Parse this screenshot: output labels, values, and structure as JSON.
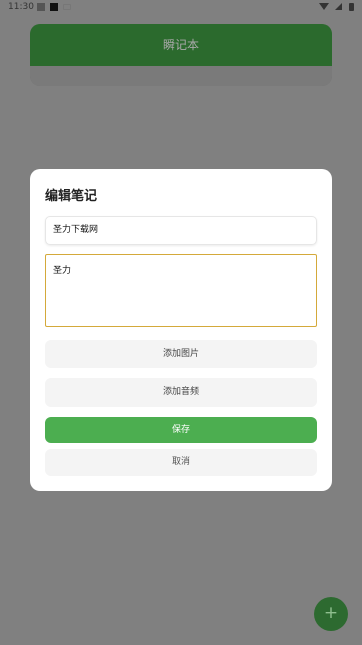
{
  "status_bar": {
    "time": "11:30"
  },
  "app": {
    "title": "瞬记本"
  },
  "dialog": {
    "title": "编辑笔记",
    "title_value": "圣力下载网",
    "body_value": "圣力",
    "add_image_label": "添加图片",
    "add_audio_label": "添加音频",
    "save_label": "保存",
    "cancel_label": "取消"
  },
  "fab": {
    "label": "+"
  },
  "colors": {
    "accent": "#4cae50",
    "header": "#2b6a2d",
    "focus_border": "#d4a93a"
  },
  "icons": [
    "wifi-icon",
    "signal-icon",
    "battery-icon",
    "add-icon"
  ]
}
